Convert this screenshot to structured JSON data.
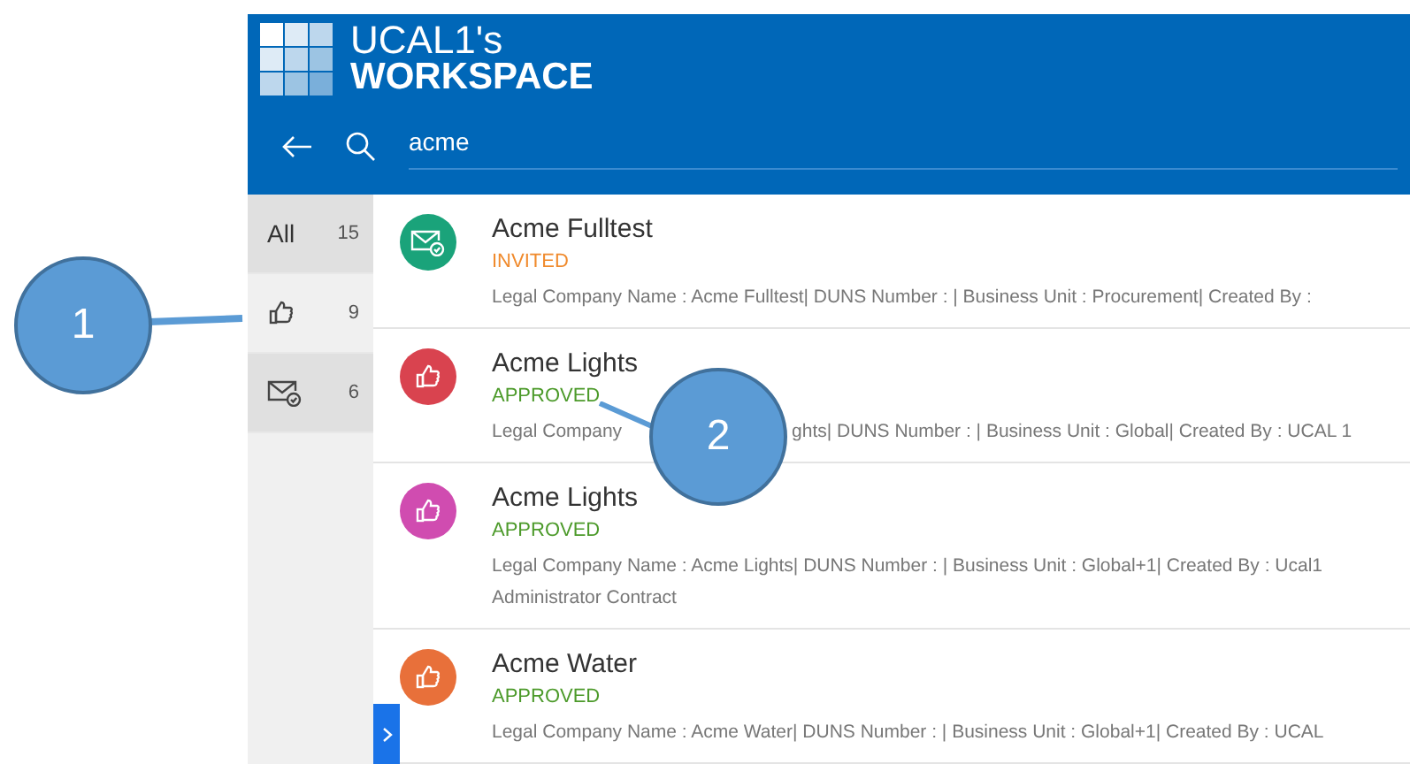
{
  "header": {
    "title_line_1": "UCAL1's",
    "title_line_2": "WORKSPACE",
    "search": {
      "value": "acme"
    }
  },
  "filters": [
    {
      "kind": "all",
      "label": "All",
      "count": "15",
      "selected": false
    },
    {
      "kind": "approved",
      "count": "9",
      "selected": true
    },
    {
      "kind": "invited",
      "count": "6",
      "selected": false
    }
  ],
  "results": [
    {
      "kind": "invited",
      "color": "#1aa37a",
      "title": "Acme Fulltest",
      "status": "INVITED",
      "details": [
        "Legal Company Name : Acme Fulltest| DUNS Number : | Business Unit : Procurement| Created By :"
      ]
    },
    {
      "kind": "approved",
      "color": "#d9434f",
      "title": "Acme Lights",
      "status": "APPROVED",
      "details": [
        "Legal Company",
        "ghts| DUNS Number : | Business Unit : Global| Created By : UCAL 1"
      ]
    },
    {
      "kind": "approved",
      "color": "#d04cb0",
      "title": "Acme Lights",
      "status": "APPROVED",
      "details": [
        "Legal Company Name : Acme Lights| DUNS Number : | Business Unit : Global+1| Created By : Ucal1"
      ],
      "details_line_2": "Administrator Contract"
    },
    {
      "kind": "approved",
      "color": "#e8703a",
      "title": "Acme Water",
      "status": "APPROVED",
      "details": [
        "Legal Company Name : Acme Water| DUNS Number : | Business Unit : Global+1| Created By : UCAL"
      ]
    }
  ],
  "callouts": [
    {
      "label": "1"
    },
    {
      "label": "2"
    }
  ]
}
